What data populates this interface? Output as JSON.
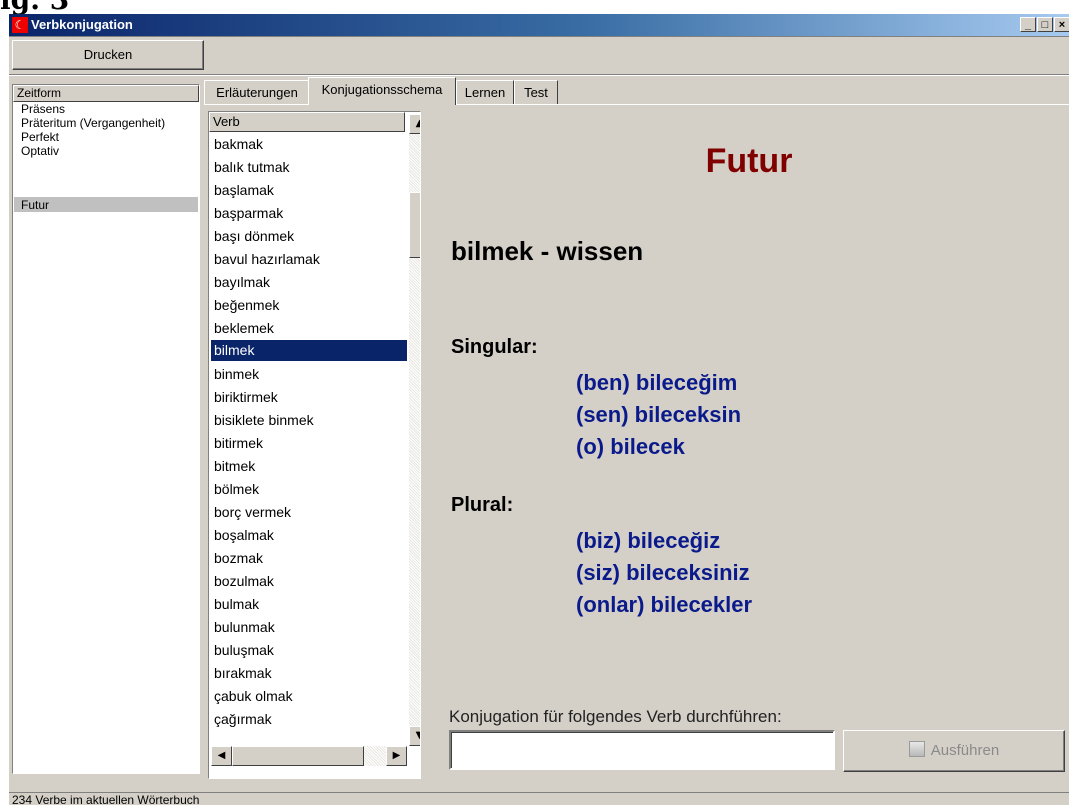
{
  "window": {
    "title": "Verbkonjugation",
    "minimize_glyph": "_",
    "maximize_glyph": "□",
    "close_glyph": "×"
  },
  "corner_fragment": "ig. 3",
  "toolbar": {
    "print_label": "Drucken"
  },
  "tense_panel": {
    "header": "Zeitform",
    "items": [
      "Präsens",
      "Präteritum (Vergangenheit)",
      "Perfekt",
      "Optativ",
      "Futur"
    ],
    "selected": "Futur"
  },
  "tabs": [
    {
      "label": "Erläuterungen",
      "active": false
    },
    {
      "label": "Konjugationsschema",
      "active": true
    },
    {
      "label": "Lernen",
      "active": false
    },
    {
      "label": "Test",
      "active": false
    }
  ],
  "verb_list": {
    "header": "Verb",
    "items": [
      "bakmak",
      "balık tutmak",
      "başlamak",
      "başparmak",
      "başı dönmek",
      "bavul hazırlamak",
      "bayılmak",
      "beğenmek",
      "beklemek",
      "bilmek",
      "binmek",
      "biriktirmek",
      "bisiklete binmek",
      "bitirmek",
      "bitmek",
      "bölmek",
      "borç vermek",
      "boşalmak",
      "bozmak",
      "bozulmak",
      "bulmak",
      "bulunmak",
      "buluşmak",
      "bırakmak",
      "çabuk olmak",
      "çağırmak"
    ],
    "selected": "bilmek"
  },
  "conjugation": {
    "tense_title": "Futur",
    "verb_heading": "bilmek - wissen",
    "singular_label": "Singular:",
    "singular": [
      "(ben) bileceğim",
      "(sen) bileceksin",
      "(o) bilecek"
    ],
    "plural_label": "Plural:",
    "plural": [
      "(biz) bileceğiz",
      "(siz) bileceksiniz",
      "(onlar) bilecekler"
    ]
  },
  "conjugate_form": {
    "prompt": "Konjugation für folgendes Verb durchführen:",
    "input_value": "",
    "run_label": "Ausführen",
    "run_icon": "execute-icon"
  },
  "status_bar": {
    "text": "234 Verbe im aktuellen Wörterbuch"
  },
  "colors": {
    "title_gradient_start": "#0a246a",
    "tense_title": "#800000",
    "conjugation_text": "#0a1a8a",
    "selection": "#0a246a",
    "window_bg": "#d4d0c8"
  }
}
